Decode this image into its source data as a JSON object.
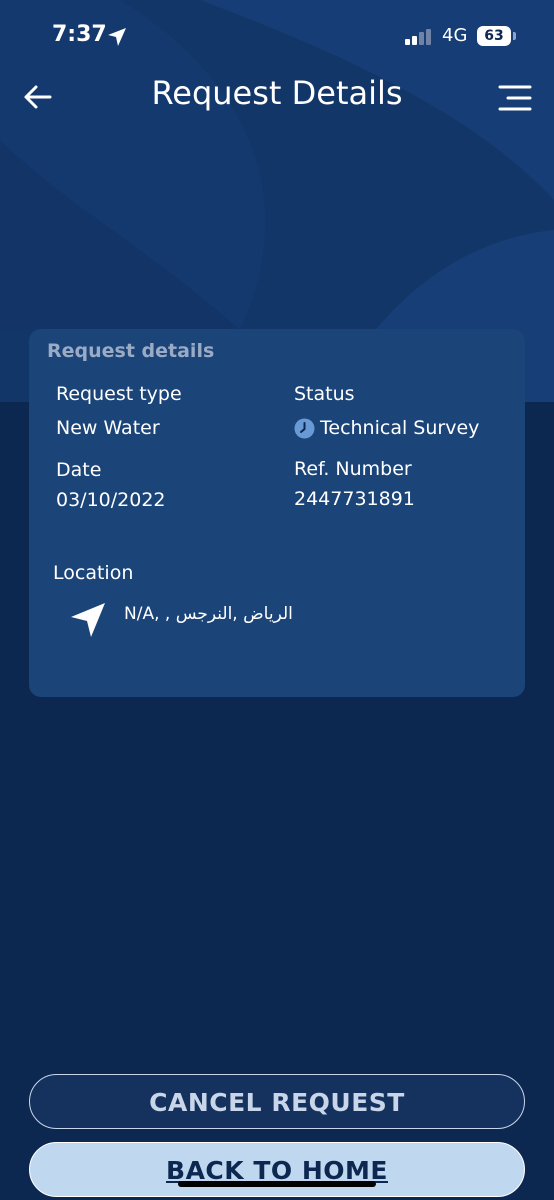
{
  "status_bar": {
    "time": "7:37",
    "network": "4G",
    "battery": "63",
    "icons": [
      "location-arrow-icon",
      "signal-icon",
      "battery-icon"
    ]
  },
  "header": {
    "title": "Request Details",
    "back_icon": "arrow-left-icon",
    "menu_icon": "hamburger-menu-icon"
  },
  "card": {
    "title": "Request details",
    "request_type_label": "Request type",
    "request_type_value": "New Water",
    "status_label": "Status",
    "status_value": "Technical Survey",
    "status_icon": "clock-icon",
    "date_label": "Date",
    "date_value": "03/10/2022",
    "ref_label": "Ref. Number",
    "ref_value": "2447731891",
    "location_label": "Location",
    "location_icon": "navigation-arrow-icon",
    "location_value": "N/A, , الرياض ,النرجس"
  },
  "buttons": {
    "cancel": "CANCEL REQUEST",
    "home": "BACK TO HOME"
  },
  "colors": {
    "background": "#0c2750",
    "hero": "#133668",
    "card": "#1b4478",
    "button_light": "#bfd8ef",
    "status_icon": "#6a9ad6"
  }
}
